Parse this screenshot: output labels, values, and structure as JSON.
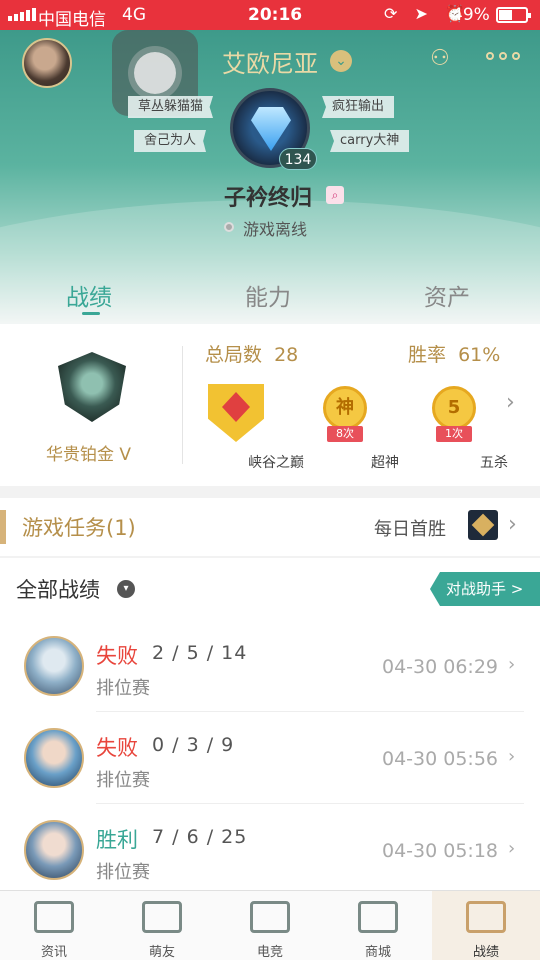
{
  "status_bar": {
    "carrier": "中国电信",
    "network": "4G",
    "time": "20:16",
    "battery": "49%",
    "icons": "⟳ ➤ ⏰"
  },
  "header": {
    "server": "艾欧尼亚",
    "server_chevron": "⌄",
    "menu_icon": "⚇",
    "tags": [
      "草丛躲猫猫",
      "疯狂输出",
      "舍己为人",
      "carry大神"
    ],
    "level": "134",
    "player_name": "子衿终归",
    "search_badge": "⌕",
    "online_status": "游戏离线"
  },
  "tabs": [
    "战绩",
    "能力",
    "资产"
  ],
  "stats": {
    "rank": "华贵铂金 V",
    "matches_label": "总局数",
    "matches_value": "28",
    "winrate_label": "胜率",
    "winrate_value": "61%",
    "achievements": [
      {
        "name": "峡谷之巅",
        "count": "",
        "glyph": ""
      },
      {
        "name": "超神",
        "count": "8次",
        "glyph": "神"
      },
      {
        "name": "五杀",
        "count": "1次",
        "glyph": "5"
      }
    ],
    "chevron": "›"
  },
  "task": {
    "title": "游戏任务(1)",
    "right_label": "每日首胜",
    "chevron": "›"
  },
  "records": {
    "title": "全部战绩",
    "dropdown": "▾",
    "assistant_button": "对战助手 >",
    "rows": [
      {
        "result": "失败",
        "kda": "2 / 5 / 14",
        "mode": "排位赛",
        "time": "04-30 06:29",
        "win": false
      },
      {
        "result": "失败",
        "kda": "0 / 3 / 9",
        "mode": "排位赛",
        "time": "04-30 05:56",
        "win": false
      },
      {
        "result": "胜利",
        "kda": "7 / 6 / 25",
        "mode": "排位赛",
        "time": "04-30 05:18",
        "win": true
      }
    ],
    "arrow": "›"
  },
  "nav": [
    "资讯",
    "萌友",
    "电竞",
    "商城",
    "战绩"
  ],
  "colors": {
    "accent": "#3aa796",
    "gold": "#b58f4a",
    "lose": "#e8453c",
    "status_bar": "#e8323c"
  }
}
